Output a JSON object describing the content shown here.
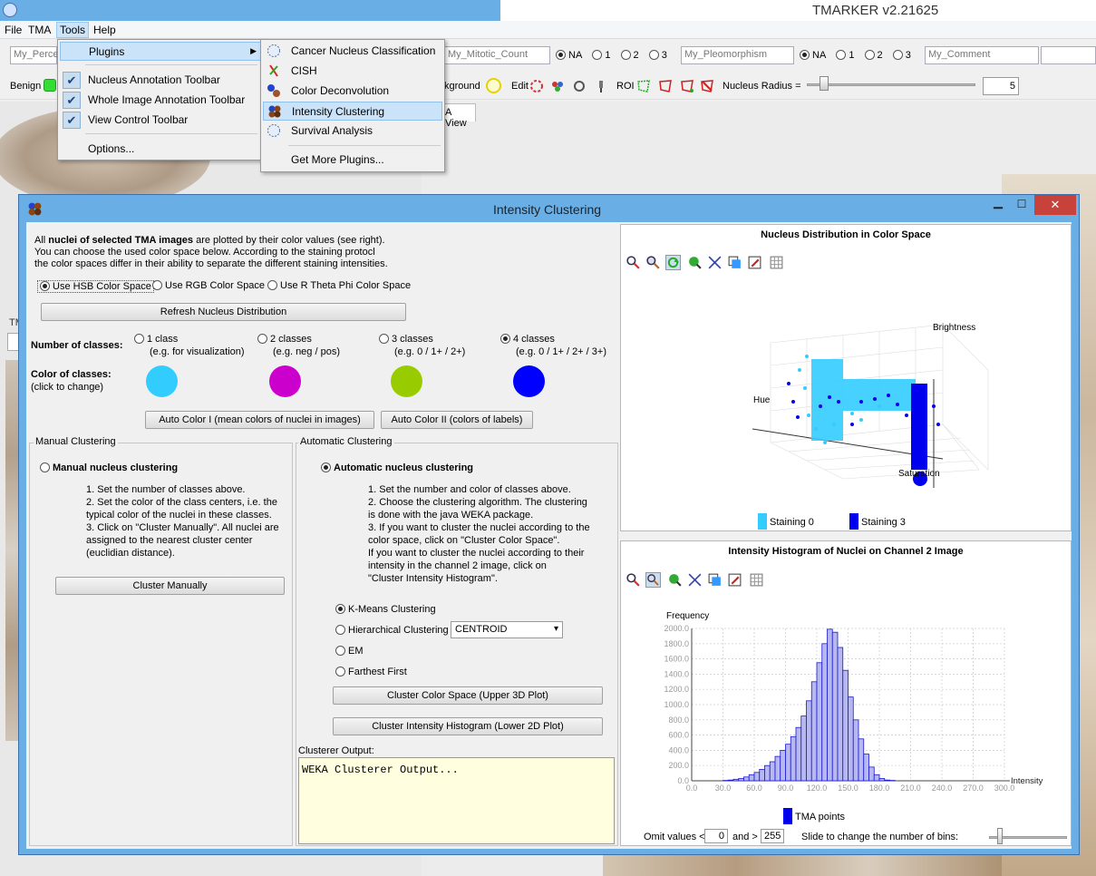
{
  "app": {
    "title": "TMARKER v2.21625"
  },
  "menubar": [
    "File",
    "TMA",
    "Tools",
    "Help"
  ],
  "tools_menu": {
    "plugins": "Plugins",
    "items": [
      "Nucleus Annotation Toolbar",
      "Whole Image Annotation Toolbar",
      "View Control Toolbar"
    ],
    "options": "Options..."
  },
  "plugins_menu": {
    "items": [
      "Cancer Nucleus Classification",
      "CISH",
      "Color Deconvolution",
      "Intensity Clustering",
      "Survival Analysis"
    ],
    "more": "Get More Plugins..."
  },
  "toolbar1": {
    "field1": "My_Perce",
    "field2": "My_Mitotic_Count",
    "field3": "My_Pleomorphism",
    "field4": "My_Comment",
    "radios": [
      "NA",
      "1",
      "2",
      "3"
    ]
  },
  "toolbar2": {
    "benign": "Benign",
    "background": "kground",
    "edit": "Edit",
    "roi": "ROI",
    "nucleus_radius": "Nucleus Radius =",
    "radius_value": "5"
  },
  "left_panel": {
    "tm_label": "TM"
  },
  "tab_label": "A View",
  "dialog": {
    "title": "Intensity Clustering",
    "intro_prefix": "All ",
    "intro_bold": "nuclei of selected TMA images",
    "intro_rest": " are plotted by their color values (see right).",
    "intro_line2": "You can choose the used color space below. According to the staining protocl",
    "intro_line3": "the color spaces differ in their ability to separate the different staining intensities.",
    "color_spaces": [
      "Use HSB Color Space",
      "Use RGB Color Space",
      "Use R Theta Phi Color Space"
    ],
    "refresh_button": "Refresh Nucleus Distribution",
    "num_classes_label": "Number of classes:",
    "classes": [
      {
        "label": "1 class",
        "example": "(e.g. for visualization)",
        "color": "#33ccff"
      },
      {
        "label": "2 classes",
        "example": "(e.g. neg / pos)",
        "color": "#cc00cc"
      },
      {
        "label": "3 classes",
        "example": "(e.g. 0 / 1+ / 2+)",
        "color": "#99cc00"
      },
      {
        "label": "4 classes",
        "example": "(e.g. 0 / 1+ / 2+ / 3+)",
        "color": "#0000ff"
      }
    ],
    "color_label": "Color of classes:",
    "color_hint": "(click to change)",
    "auto_color_1": "Auto Color I (mean colors of nuclei in images)",
    "auto_color_2": "Auto Color II (colors of labels)",
    "manual": {
      "panel_title": "Manual Clustering",
      "option": "Manual nucleus clustering",
      "steps": [
        "1.  Set the number of classes above.",
        "2.  Set the color of the class centers, i.e. the",
        "     typical color of the nuclei in these classes.",
        "3.  Click on \"Cluster Manually\". All nuclei are",
        "     assigned to the nearest cluster center",
        "     (euclidian distance)."
      ],
      "button": "Cluster Manually"
    },
    "automatic": {
      "panel_title": "Automatic Clustering",
      "option": "Automatic nucleus clustering",
      "steps": [
        "1.  Set the number and color of classes above.",
        "2.  Choose the clustering algorithm. The clustering",
        "     is done with the java WEKA package.",
        "3.  If you want to cluster the nuclei according to the",
        "     color space, click on \"Cluster Color Space\".",
        "     If you want to cluster the nuclei according to their",
        "     intensity in the channel 2 image, click on",
        "     \"Cluster Intensity Histogram\"."
      ],
      "algorithms": [
        "K-Means Clustering",
        "Hierarchical Clustering",
        "EM",
        "Farthest First"
      ],
      "hier_option": "CENTROID",
      "btn_color_space": "Cluster Color Space (Upper 3D Plot)",
      "btn_histogram": "Cluster Intensity Histogram (Lower 2D Plot)",
      "output_label": "Clusterer Output:",
      "output_text": "WEKA Clusterer Output..."
    },
    "plot3d": {
      "title": "Nucleus Distribution in Color Space",
      "axis_brightness": "Brightness",
      "axis_hue": "Hue",
      "axis_saturation": "Saturation",
      "legend": [
        "Staining 0",
        "Staining 3"
      ],
      "legend_colors": [
        "#33ccff",
        "#0000ee"
      ]
    },
    "histogram": {
      "title": "Intensity Histogram of Nuclei on Channel 2 Image",
      "ylabel": "Frequency",
      "xlabel": "Intensity",
      "legend": "TMA points",
      "omit_label": "Omit values <",
      "omit_low": "0",
      "and_label": "and >",
      "omit_high": "255",
      "bins_label": "Slide to change the number of bins:"
    }
  },
  "chart_data": {
    "type": "bar",
    "title": "Intensity Histogram of Nuclei on Channel 2 Image",
    "xlabel": "Intensity",
    "ylabel": "Frequency",
    "xlim": [
      0,
      300
    ],
    "ylim": [
      0,
      2000
    ],
    "xticks": [
      "0.0",
      "30.0",
      "60.0",
      "90.0",
      "120.0",
      "150.0",
      "180.0",
      "210.0",
      "240.0",
      "270.0",
      "300.0"
    ],
    "yticks": [
      "0.0",
      "200.0",
      "400.0",
      "600.0",
      "800.0",
      "1000.0",
      "1200.0",
      "1400.0",
      "1600.0",
      "1800.0",
      "2000.0"
    ],
    "bin_width": 5,
    "x": [
      30,
      35,
      40,
      45,
      50,
      55,
      60,
      65,
      70,
      75,
      80,
      85,
      90,
      95,
      100,
      105,
      110,
      115,
      120,
      125,
      130,
      135,
      140,
      145,
      150,
      155,
      160,
      165,
      170,
      175,
      180,
      185,
      190
    ],
    "values": [
      5,
      10,
      20,
      30,
      50,
      80,
      110,
      150,
      200,
      250,
      320,
      400,
      480,
      580,
      700,
      850,
      1050,
      1300,
      1550,
      1800,
      1990,
      1950,
      1750,
      1450,
      1100,
      800,
      550,
      350,
      180,
      80,
      30,
      10,
      5
    ],
    "series": [
      {
        "name": "TMA points",
        "color": "#0000ee"
      }
    ]
  }
}
